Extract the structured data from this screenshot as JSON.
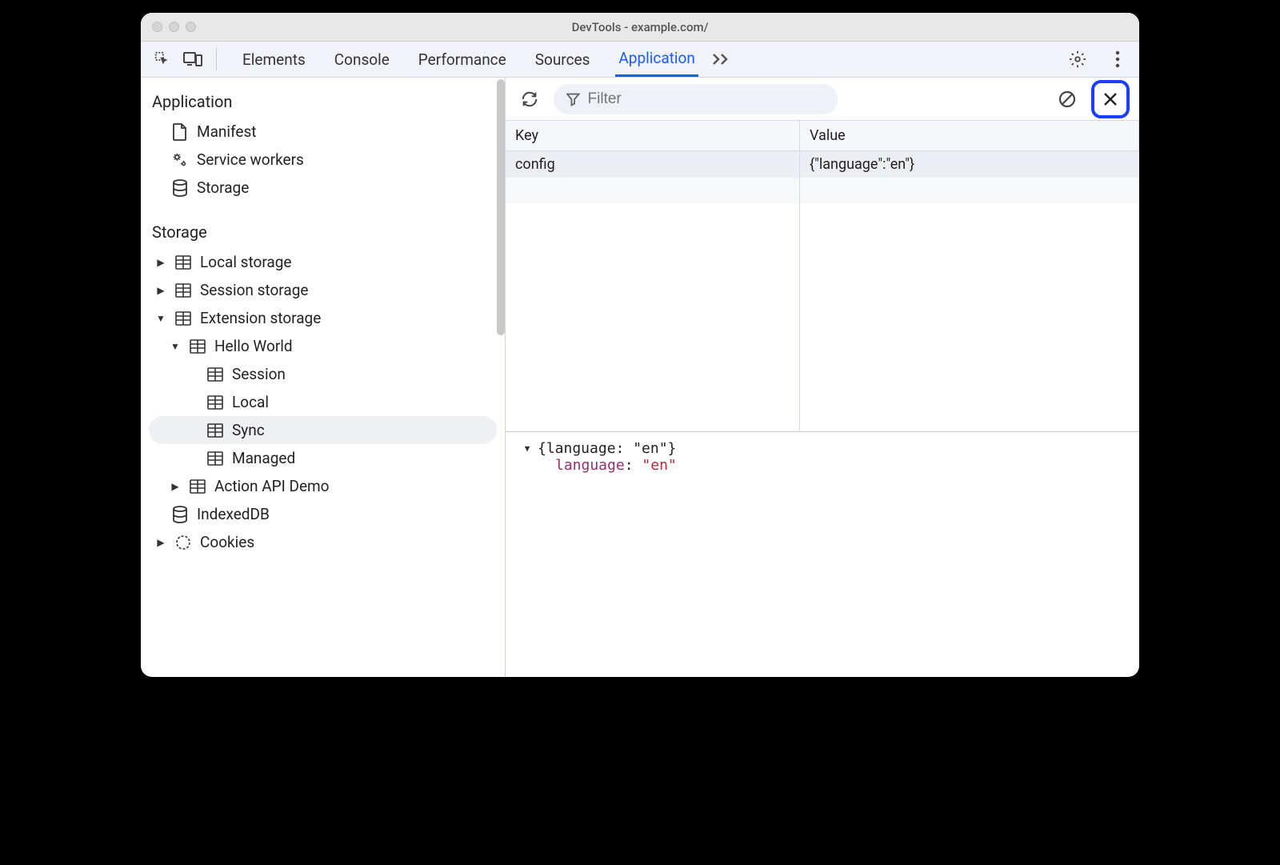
{
  "window": {
    "title": "DevTools - example.com/"
  },
  "toolbar": {
    "tabs": [
      "Elements",
      "Console",
      "Performance",
      "Sources",
      "Application"
    ],
    "active_tab_index": 4
  },
  "sidebar": {
    "application": {
      "header": "Application",
      "items": [
        "Manifest",
        "Service workers",
        "Storage"
      ]
    },
    "storage": {
      "header": "Storage",
      "local_storage": "Local storage",
      "session_storage": "Session storage",
      "extension_storage": "Extension storage",
      "indexeddb": "IndexedDB",
      "cookies": "Cookies",
      "ext": {
        "hello_world": "Hello World",
        "action_api_demo": "Action API Demo",
        "areas": [
          "Session",
          "Local",
          "Sync",
          "Managed"
        ],
        "selected_area_index": 2
      }
    }
  },
  "filter": {
    "placeholder": "Filter"
  },
  "table": {
    "headers": {
      "key": "Key",
      "value": "Value"
    },
    "rows": [
      {
        "key": "config",
        "value": "{\"language\":\"en\"}"
      }
    ]
  },
  "detail": {
    "summary": "{language: \"en\"}",
    "prop_name": "language",
    "prop_value": "\"en\""
  }
}
